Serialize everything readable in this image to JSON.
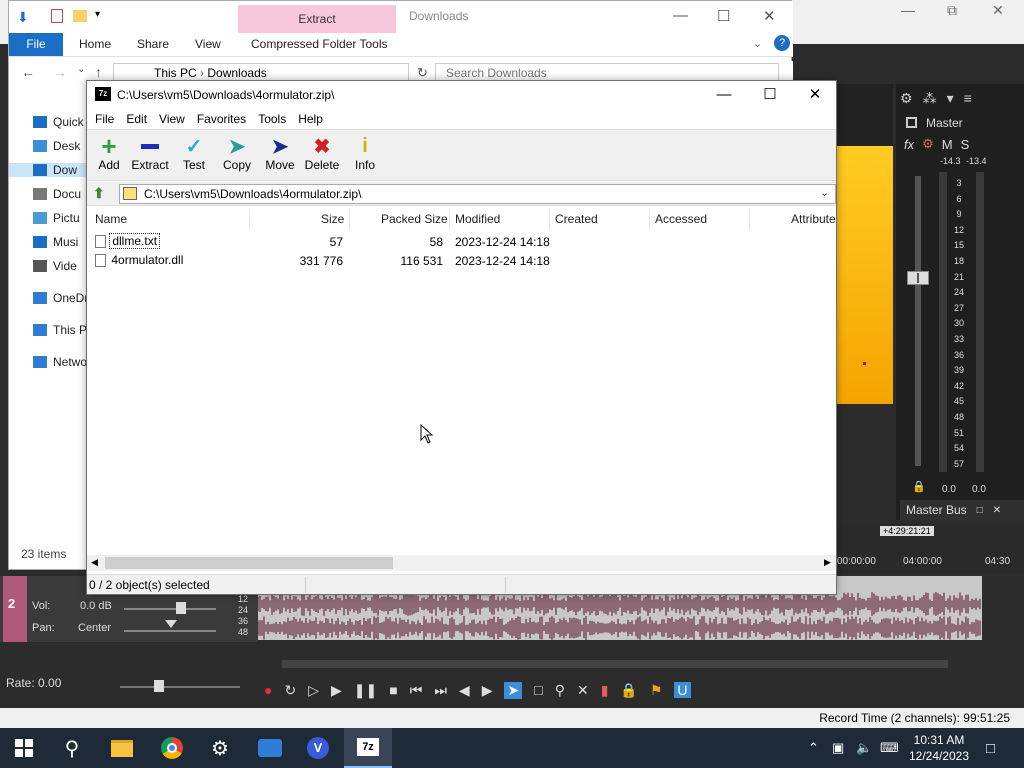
{
  "explorer": {
    "title": "Downloads",
    "contextual_tab": "Extract",
    "ribbon_tabs": [
      "File",
      "Home",
      "Share",
      "View",
      "Compressed Folder Tools"
    ],
    "breadcrumb": [
      "This PC",
      "Downloads"
    ],
    "search_placeholder": "Search Downloads",
    "nav_items": [
      "Quick",
      "Desk",
      "Dow",
      "Docu",
      "Pictu",
      "Musi",
      "Vide",
      "OneDr",
      "This P",
      "Netwo"
    ],
    "status": "23 items"
  },
  "sevenzip": {
    "title": "C:\\Users\\vm5\\Downloads\\4ormulator.zip\\",
    "menu": [
      "File",
      "Edit",
      "View",
      "Favorites",
      "Tools",
      "Help"
    ],
    "toolbar": [
      {
        "label": "Add",
        "icon": "plus-icon",
        "color": "#2ea043"
      },
      {
        "label": "Extract",
        "icon": "minus-icon",
        "color": "#1d2fb8"
      },
      {
        "label": "Test",
        "icon": "check-icon",
        "color": "#27b0c7"
      },
      {
        "label": "Copy",
        "icon": "copy-arrow-icon",
        "color": "#2a9c9c"
      },
      {
        "label": "Move",
        "icon": "move-arrow-icon",
        "color": "#1a2b8c"
      },
      {
        "label": "Delete",
        "icon": "delete-x-icon",
        "color": "#d42020"
      },
      {
        "label": "Info",
        "icon": "info-icon",
        "color": "#c9b400"
      }
    ],
    "path": "C:\\Users\\vm5\\Downloads\\4ormulator.zip\\",
    "columns": [
      "Name",
      "Size",
      "Packed Size",
      "Modified",
      "Created",
      "Accessed",
      "Attribute"
    ],
    "files": [
      {
        "name": "dllme.txt",
        "size": "57",
        "packed": "58",
        "modified": "2023-12-24 14:18"
      },
      {
        "name": "4ormulator.dll",
        "size": "331 776",
        "packed": "116 531",
        "modified": "2023-12-24 14:18"
      }
    ],
    "status": "0 / 2 object(s) selected"
  },
  "vegas": {
    "mixer": {
      "master_label": "Master",
      "fx_label": "fx",
      "m_label": "M",
      "s_label": "S",
      "peak_left": "-14.3",
      "peak_right": "-13.4",
      "scale": [
        "3",
        "6",
        "9",
        "12",
        "15",
        "18",
        "21",
        "24",
        "27",
        "30",
        "33",
        "36",
        "39",
        "42",
        "45",
        "48",
        "51",
        "54",
        "57"
      ],
      "bottom_left": "0.0",
      "bottom_right": "0.0",
      "bus_label": "Master Bus"
    },
    "timeline_tag": "+4:29:21:21",
    "ruler": [
      "00:00:00",
      "04:00:00",
      "04:30"
    ],
    "track": {
      "number": "2",
      "vol_label": "Vol:",
      "vol_value": "0.0 dB",
      "pan_label": "Pan:",
      "pan_value": "Center",
      "db_marks": [
        "12",
        "24",
        "36",
        "48"
      ]
    },
    "rate": "Rate: 0.00",
    "record_time": "Record Time (2 channels): 99:51:25"
  },
  "taskbar": {
    "time": "10:31 AM",
    "date": "12/24/2023",
    "apps": [
      "start-icon",
      "search-icon",
      "file-explorer-icon",
      "chrome-icon",
      "settings-icon",
      "people-icon",
      "vegas-icon",
      "sevenzip-icon"
    ]
  }
}
